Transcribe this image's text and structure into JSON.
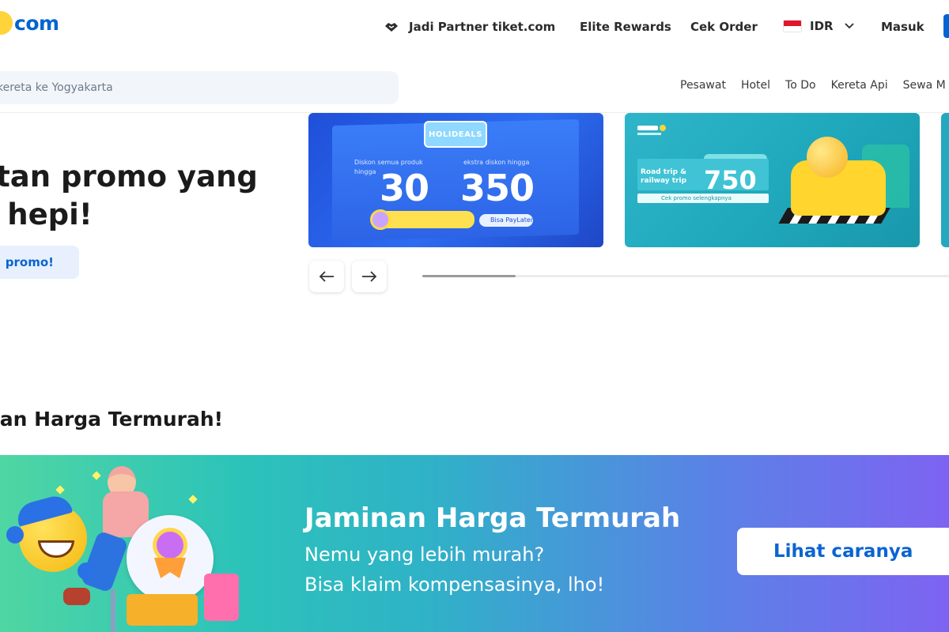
{
  "header": {
    "logo_text": "com",
    "nav": {
      "partner": "Jadi Partner tiket.com",
      "elite": "Elite Rewards",
      "cek_order": "Cek Order",
      "currency": "IDR",
      "login": "Masuk"
    }
  },
  "search": {
    "placeholder": "kereta ke Yogyakarta"
  },
  "subnav": [
    "Pesawat",
    "Hotel",
    "To Do",
    "Kereta Api",
    "Sewa M"
  ],
  "hero": {
    "title_line1": "etan promo yang",
    "title_line2": "n hepi!",
    "button": "promo!"
  },
  "promos": [
    {
      "badge": "HOLIDEALS",
      "left_caption": "Diskon semua produk",
      "left_caption2": "hingga",
      "left_value": "30",
      "right_caption": "ekstra diskon hingga",
      "right_value": "350",
      "footer": "Bisa PayLater"
    },
    {
      "label": "Road trip & railway trip",
      "value": "750",
      "footer": "Cek promo selengkapnya"
    }
  ],
  "section": {
    "title": "nan Harga Termurah!"
  },
  "banner": {
    "title": "Jaminan Harga Termurah",
    "line1": "Nemu yang lebih murah?",
    "line2": "Bisa klaim kompensasinya, lho!",
    "cta": "Lihat caranya"
  },
  "colors": {
    "brand_blue": "#0064d2",
    "brand_yellow": "#ffd43a",
    "banner_start": "#4fd6a3",
    "banner_end": "#7e63f2"
  },
  "icons": {
    "partner": "handshake-icon",
    "currency_flag": "indonesia-flag-icon",
    "chevron": "chevron-down-icon",
    "prev": "arrow-left-icon",
    "next": "arrow-right-icon"
  }
}
